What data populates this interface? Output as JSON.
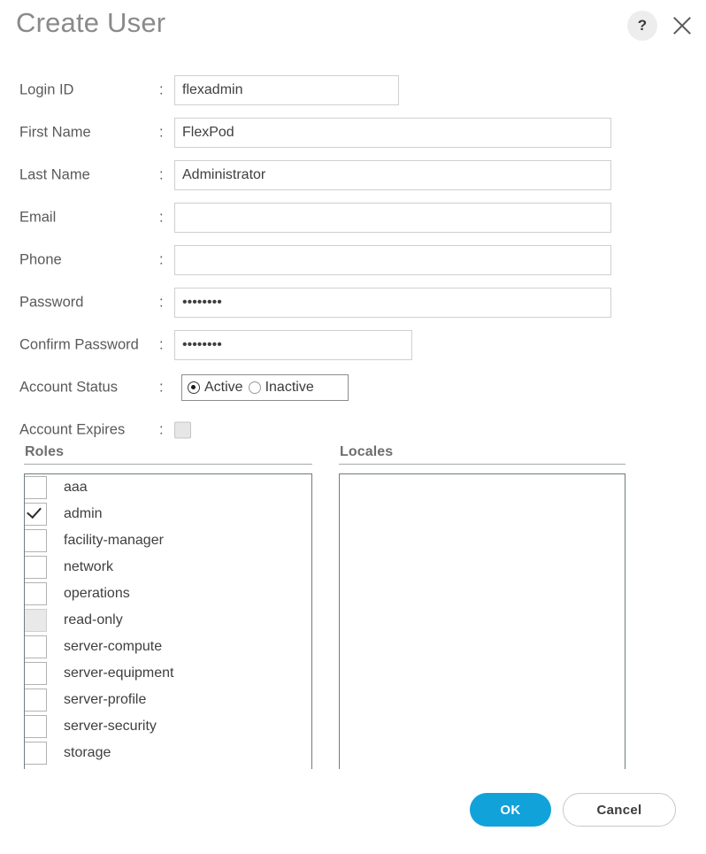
{
  "header": {
    "title": "Create User",
    "help_icon": "?",
    "help_icon_name": "help-icon",
    "close_icon_name": "close-icon"
  },
  "form": {
    "colon": ":",
    "fields": [
      {
        "label": "Login ID",
        "value": "flexadmin",
        "placeholder": ""
      },
      {
        "label": "First Name",
        "value": "FlexPod",
        "placeholder": ""
      },
      {
        "label": "Last Name",
        "value": "Administrator",
        "placeholder": ""
      },
      {
        "label": "Email",
        "value": "",
        "placeholder": ""
      },
      {
        "label": "Phone",
        "value": "",
        "placeholder": ""
      },
      {
        "label": "Password",
        "value": "••••••••",
        "placeholder": ""
      },
      {
        "label": "Confirm Password",
        "value": "••••••••",
        "placeholder": ""
      }
    ],
    "account_status": {
      "label": "Account Status",
      "options": [
        "Active",
        "Inactive"
      ],
      "selected": "Active"
    },
    "account_expires": {
      "label": "Account Expires",
      "checked": false
    }
  },
  "lists": {
    "roles": {
      "heading": "Roles",
      "items": [
        {
          "name": "aaa",
          "checked": false,
          "disabled": false
        },
        {
          "name": "admin",
          "checked": true,
          "disabled": false
        },
        {
          "name": "facility-manager",
          "checked": false,
          "disabled": false
        },
        {
          "name": "network",
          "checked": false,
          "disabled": false
        },
        {
          "name": "operations",
          "checked": false,
          "disabled": false
        },
        {
          "name": "read-only",
          "checked": false,
          "disabled": true
        },
        {
          "name": "server-compute",
          "checked": false,
          "disabled": false
        },
        {
          "name": "server-equipment",
          "checked": false,
          "disabled": false
        },
        {
          "name": "server-profile",
          "checked": false,
          "disabled": false
        },
        {
          "name": "server-security",
          "checked": false,
          "disabled": false
        },
        {
          "name": "storage",
          "checked": false,
          "disabled": false
        }
      ]
    },
    "locales": {
      "heading": "Locales",
      "items": []
    }
  },
  "footer": {
    "ok_label": "OK",
    "cancel_label": "Cancel"
  },
  "colors": {
    "accent": "#11a2d9",
    "title": "#8a8a8a",
    "label": "#5a5a5a",
    "border": "#cfcfcf",
    "list_border": "#6f7b82",
    "scrollbar": "#a6a6a6"
  }
}
